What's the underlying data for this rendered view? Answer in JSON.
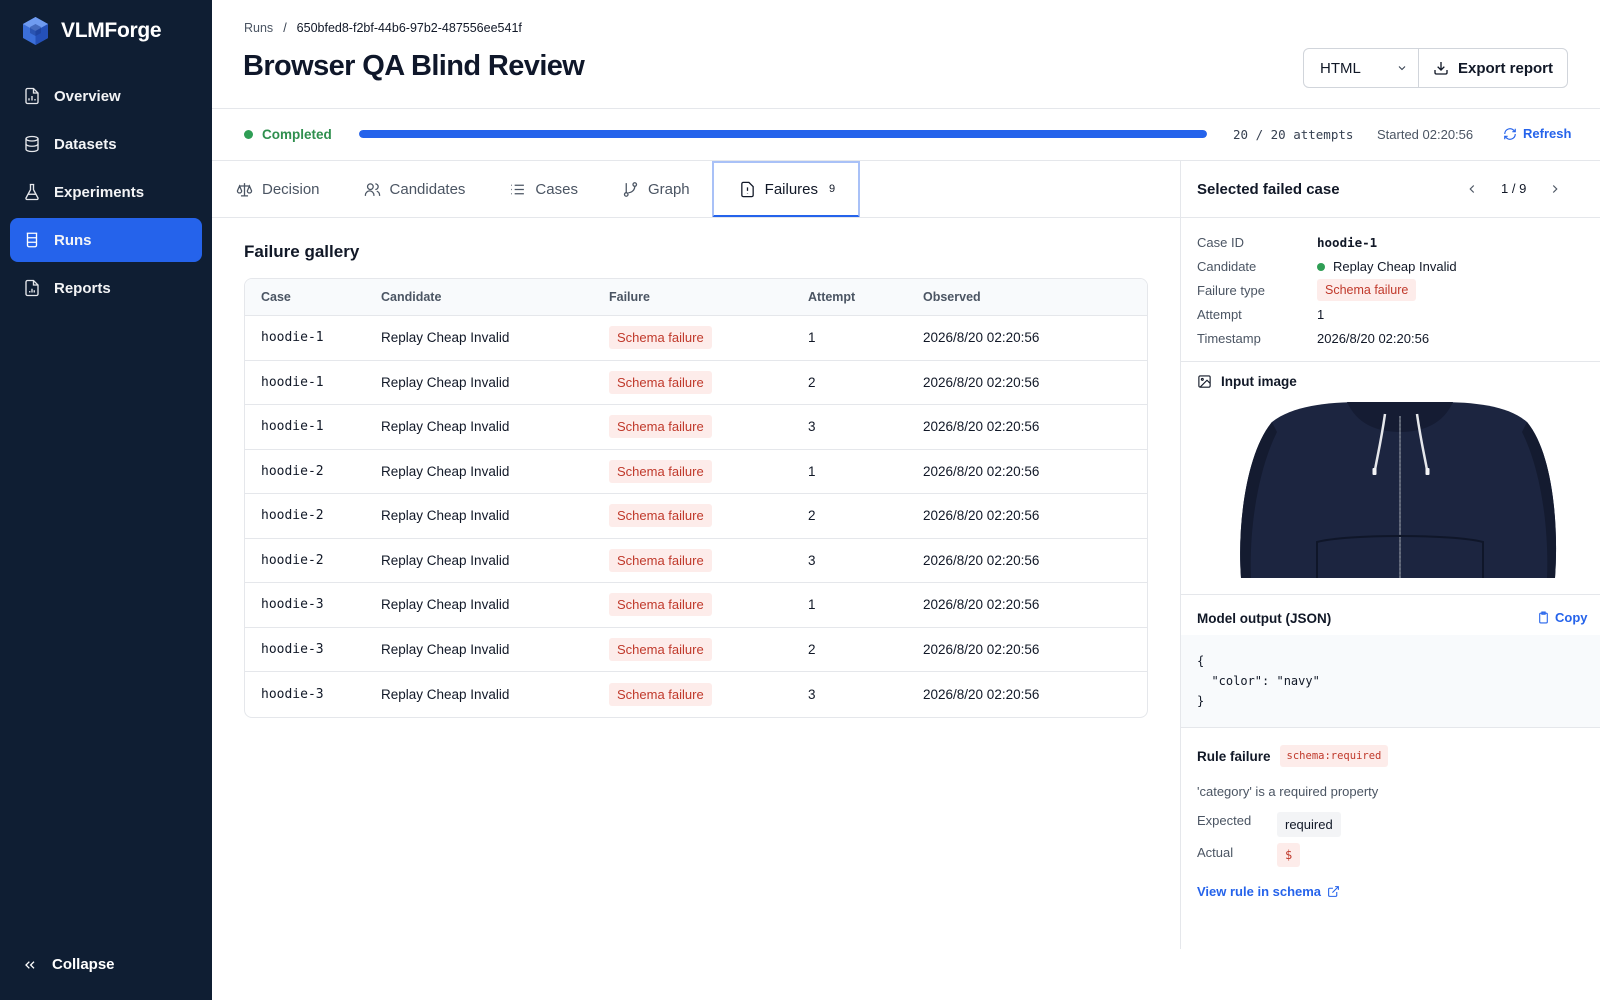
{
  "app": {
    "name": "VLMForge"
  },
  "sidebar": {
    "items": [
      {
        "label": "Overview",
        "icon": "file-chart-icon"
      },
      {
        "label": "Datasets",
        "icon": "database-icon"
      },
      {
        "label": "Experiments",
        "icon": "flask-icon"
      },
      {
        "label": "Runs",
        "icon": "beaker-icon",
        "active": true
      },
      {
        "label": "Reports",
        "icon": "report-icon"
      }
    ],
    "collapse_label": "Collapse"
  },
  "breadcrumb": {
    "parent": "Runs",
    "separator": "/",
    "current": "650bfed8-f2bf-44b6-97b2-487556ee541f"
  },
  "header": {
    "title": "Browser QA Blind Review",
    "format_value": "HTML",
    "export_label": "Export report"
  },
  "status": {
    "label": "Completed",
    "color": "#2f9e55",
    "progress_fraction": 1.0,
    "attempts": "20 / 20 attempts",
    "started": "Started 02:20:56",
    "refresh_label": "Refresh"
  },
  "tabs": [
    {
      "label": "Decision",
      "icon": "scale-icon"
    },
    {
      "label": "Candidates",
      "icon": "users-icon"
    },
    {
      "label": "Cases",
      "icon": "list-icon"
    },
    {
      "label": "Graph",
      "icon": "git-branch-icon"
    },
    {
      "label": "Failures",
      "icon": "file-alert-icon",
      "count": "9",
      "active": true
    }
  ],
  "gallery": {
    "title": "Failure gallery",
    "columns": [
      "Case",
      "Candidate",
      "Failure",
      "Attempt",
      "Observed"
    ],
    "rows": [
      {
        "case": "hoodie-1",
        "candidate": "Replay Cheap Invalid",
        "failure": "Schema failure",
        "attempt": "1",
        "observed": "2026/8/20 02:20:56"
      },
      {
        "case": "hoodie-1",
        "candidate": "Replay Cheap Invalid",
        "failure": "Schema failure",
        "attempt": "2",
        "observed": "2026/8/20 02:20:56"
      },
      {
        "case": "hoodie-1",
        "candidate": "Replay Cheap Invalid",
        "failure": "Schema failure",
        "attempt": "3",
        "observed": "2026/8/20 02:20:56"
      },
      {
        "case": "hoodie-2",
        "candidate": "Replay Cheap Invalid",
        "failure": "Schema failure",
        "attempt": "1",
        "observed": "2026/8/20 02:20:56"
      },
      {
        "case": "hoodie-2",
        "candidate": "Replay Cheap Invalid",
        "failure": "Schema failure",
        "attempt": "2",
        "observed": "2026/8/20 02:20:56"
      },
      {
        "case": "hoodie-2",
        "candidate": "Replay Cheap Invalid",
        "failure": "Schema failure",
        "attempt": "3",
        "observed": "2026/8/20 02:20:56"
      },
      {
        "case": "hoodie-3",
        "candidate": "Replay Cheap Invalid",
        "failure": "Schema failure",
        "attempt": "1",
        "observed": "2026/8/20 02:20:56"
      },
      {
        "case": "hoodie-3",
        "candidate": "Replay Cheap Invalid",
        "failure": "Schema failure",
        "attempt": "2",
        "observed": "2026/8/20 02:20:56"
      },
      {
        "case": "hoodie-3",
        "candidate": "Replay Cheap Invalid",
        "failure": "Schema failure",
        "attempt": "3",
        "observed": "2026/8/20 02:20:56"
      }
    ]
  },
  "detail": {
    "title": "Selected failed case",
    "pager": "1 / 9",
    "fields": {
      "case_id_label": "Case ID",
      "case_id": "hoodie-1",
      "candidate_label": "Candidate",
      "candidate": "Replay Cheap Invalid",
      "failure_type_label": "Failure type",
      "failure_type": "Schema failure",
      "attempt_label": "Attempt",
      "attempt": "1",
      "timestamp_label": "Timestamp",
      "timestamp": "2026/8/20 02:20:56"
    },
    "input_image_label": "Input image",
    "model_output_label": "Model output (JSON)",
    "copy_label": "Copy",
    "model_output": "{\n  \"color\": \"navy\"\n}",
    "rule_failure_label": "Rule failure",
    "rule_tag": "schema:required",
    "rule_message": "'category' is a required property",
    "expected_label": "Expected",
    "expected": "required",
    "actual_label": "Actual",
    "actual": "$",
    "view_rule_label": "View rule in schema"
  },
  "colors": {
    "sidebar_bg": "#0f1e33",
    "accent": "#2563eb",
    "success": "#2f9e55",
    "danger": "#c0392b"
  }
}
